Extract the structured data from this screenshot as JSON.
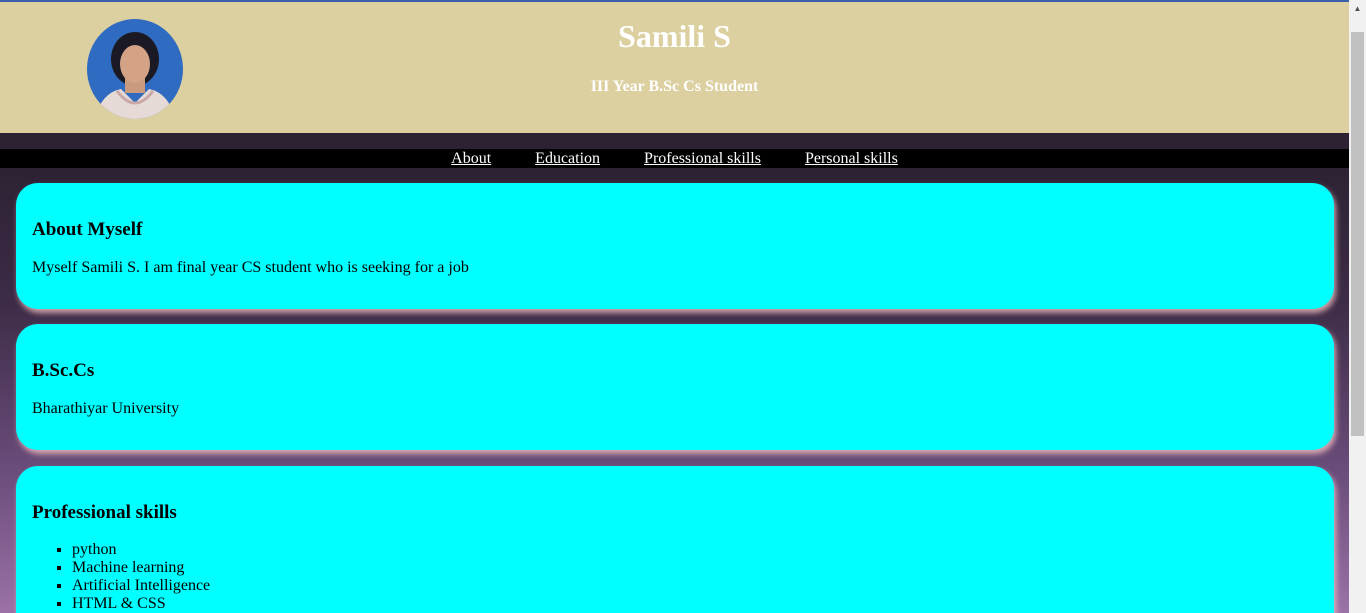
{
  "header": {
    "name": "Samili S",
    "subtitle": "III Year B.Sc Cs Student",
    "avatar_icon": "profile-photo"
  },
  "nav": {
    "items": [
      "About",
      "Education",
      "Professional skills",
      "Personal skills"
    ]
  },
  "sections": {
    "about": {
      "title": "About Myself",
      "text": "Myself Samili S. I am final year CS student who is seeking for a job"
    },
    "education": {
      "title": "B.Sc.Cs",
      "text": "Bharathiyar University"
    },
    "professional": {
      "title": "Professional skills",
      "items": [
        "python",
        "Machine learning",
        "Artificial Intelligence",
        "HTML & CSS"
      ]
    }
  },
  "colors": {
    "header_bg": "#dccfa0",
    "card_bg": "#00ffff",
    "nav_bg": "#000000"
  },
  "scrollbar": {
    "up_icon": "scroll-up-arrow"
  }
}
